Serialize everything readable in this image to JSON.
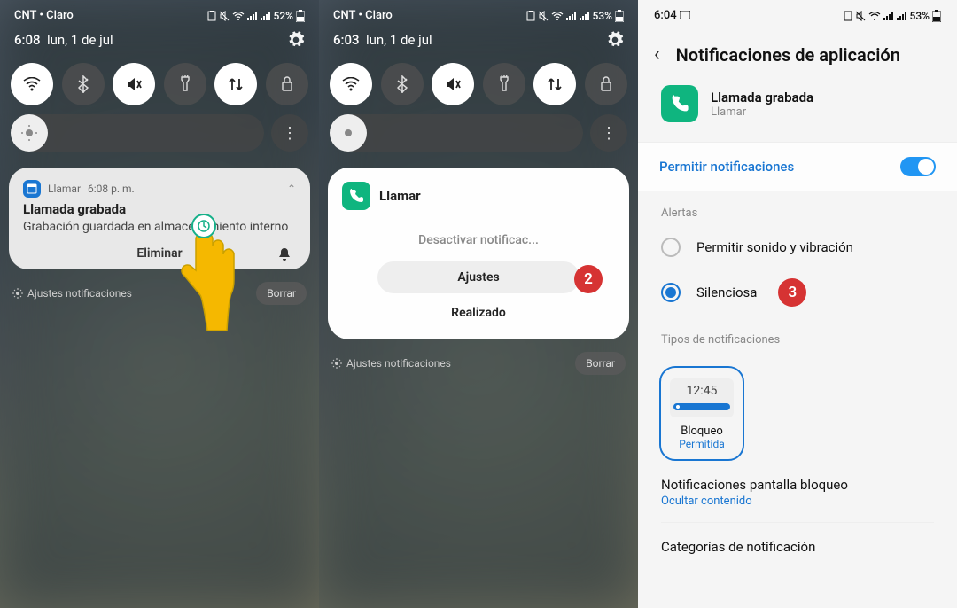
{
  "panel1": {
    "status": {
      "carrier": "CNT • Claro",
      "battery": "52%"
    },
    "time": "6:08",
    "date": "lun, 1 de jul",
    "notification": {
      "app": "Llamar",
      "time": "6:08 p. m.",
      "title": "Llamada grabada",
      "body": "Grabación guardada en almacenamiento interno",
      "action": "Eliminar"
    },
    "footer_settings": "Ajustes notificaciones",
    "footer_clear": "Borrar"
  },
  "panel2": {
    "status": {
      "carrier": "CNT • Claro",
      "battery": "53%"
    },
    "time": "6:03",
    "date": "lun, 1 de jul",
    "card": {
      "app": "Llamar",
      "option1": "Desactivar notificac...",
      "option2": "Ajustes",
      "option3": "Realizado",
      "step": "2"
    },
    "footer_settings": "Ajustes notificaciones",
    "footer_clear": "Borrar"
  },
  "panel3": {
    "status": {
      "time": "6:04",
      "battery": "53%"
    },
    "title": "Notificaciones de aplicación",
    "app": {
      "name": "Llamada grabada",
      "sub": "Llamar"
    },
    "allow_label": "Permitir notificaciones",
    "alerts_header": "Alertas",
    "radio1": "Permitir sonido y vibración",
    "radio2": "Silenciosa",
    "step": "3",
    "types_header": "Tipos de notificaciones",
    "type_card": {
      "preview_time": "12:45",
      "name": "Bloqueo",
      "status": "Permitida"
    },
    "lock_row": {
      "title": "Notificaciones pantalla bloqueo",
      "sub": "Ocultar contenido"
    },
    "categories": "Categorías de notificación"
  }
}
